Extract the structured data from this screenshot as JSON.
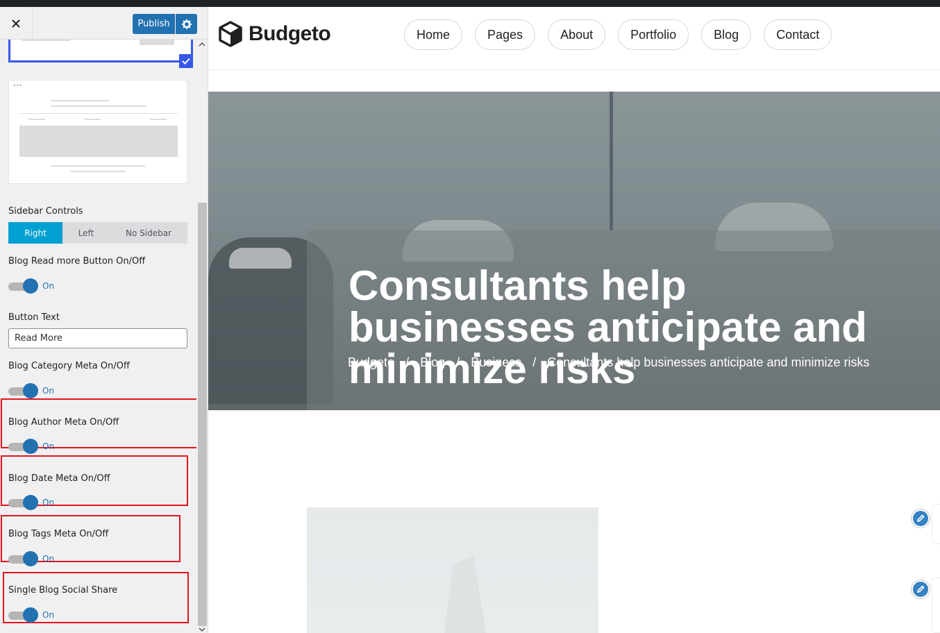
{
  "customizer": {
    "publish_label": "Publish",
    "icons": {
      "close": "close-icon",
      "settings": "gear-icon",
      "selected": "checkmark-icon",
      "scroll_up": "chevron-up-icon",
      "scroll_down": "chevron-down-icon"
    },
    "sidebar_controls": {
      "label": "Sidebar Controls",
      "options": [
        "Right",
        "Left",
        "No Sidebar"
      ],
      "selected": "Right"
    },
    "read_more": {
      "label": "Blog Read more Button On/Off",
      "state": "On"
    },
    "button_text": {
      "label": "Button Text",
      "value": "Read More"
    },
    "category_meta": {
      "label": "Blog Category Meta On/Off",
      "state": "On"
    },
    "author_meta": {
      "label": "Blog Author Meta On/Off",
      "state": "On"
    },
    "date_meta": {
      "label": "Blog Date Meta On/Off",
      "state": "On"
    },
    "tags_meta": {
      "label": "Blog Tags Meta On/Off",
      "state": "On"
    },
    "social_share": {
      "label": "Single Blog Social Share",
      "state": "On"
    },
    "colors": {
      "accent": "#2271b1",
      "segment_active": "#00a0d2",
      "highlight": "#e2141c",
      "selected_border": "#3858e9"
    }
  },
  "site": {
    "logo_text": "Budgeto",
    "logo_icon": "cube-icon",
    "nav": [
      "Home",
      "Pages",
      "About",
      "Portfolio",
      "Blog",
      "Contact"
    ],
    "hero": {
      "title": "Consultants help businesses anticipate and minimize risks",
      "breadcrumb": [
        "Budgeto",
        "/",
        "Blog",
        "/",
        "Business",
        "/",
        "Consultants help businesses anticipate and minimize risks"
      ]
    },
    "edit_icon": "pencil-icon"
  }
}
